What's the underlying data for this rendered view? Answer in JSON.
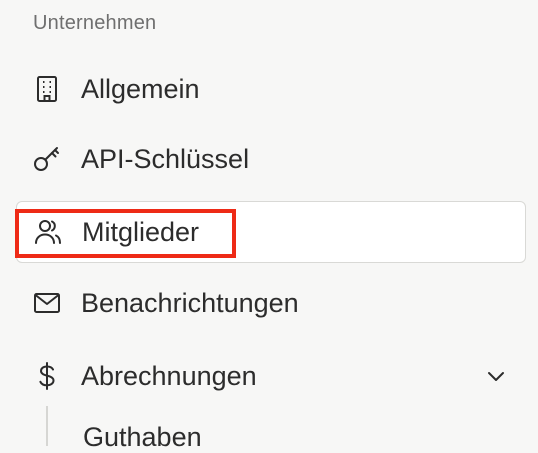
{
  "sidebar": {
    "section_title": "Unternehmen",
    "items": [
      {
        "label": "Allgemein",
        "icon": "building-icon"
      },
      {
        "label": "API-Schlüssel",
        "icon": "key-icon"
      },
      {
        "label": "Mitglieder",
        "icon": "users-icon",
        "active": true
      },
      {
        "label": "Benachrichtungen",
        "icon": "mail-icon"
      },
      {
        "label": "Abrechnungen",
        "icon": "dollar-icon",
        "expanded": true
      }
    ],
    "subitems": [
      {
        "label": "Guthaben"
      }
    ]
  },
  "colors": {
    "background": "#f7f7f6",
    "active_background": "#ffffff",
    "highlight": "#ee2a16",
    "text": "#2c2c2c",
    "muted": "#6f6f6f"
  }
}
